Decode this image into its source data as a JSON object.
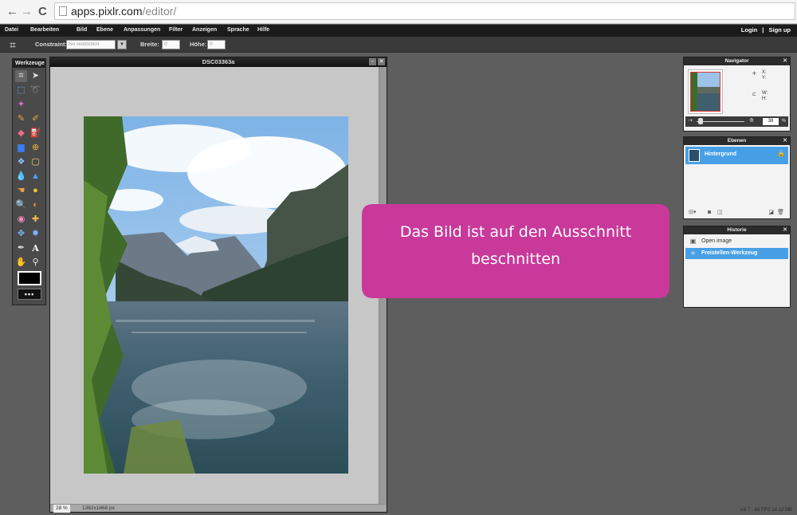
{
  "browser": {
    "back_icon": "arrow-left-icon",
    "forward_icon": "arrow-right-icon",
    "reload_icon": "reload-icon",
    "url_host": "apps.pixlr.com",
    "url_path": "/editor/"
  },
  "menu": {
    "items": [
      "Datei",
      "Bearbeiten",
      "Bild",
      "Ebene",
      "Anpassungen",
      "Filter",
      "Anzeigen",
      "Sprache",
      "Hilfe"
    ],
    "login": "Login",
    "separator": "|",
    "signup": "Sign up"
  },
  "options": {
    "constraint_label": "Constraint:",
    "constraint_value": "No restriction",
    "width_label": "Breite:",
    "width_value": "0",
    "height_label": "Höhe:",
    "height_value": "0"
  },
  "tools": {
    "title": "Werkzeuge",
    "items": [
      "crop-icon",
      "move-icon",
      "marquee-icon",
      "lasso-icon",
      "wand-icon",
      "pencil-icon",
      "brush-icon",
      "eraser-icon",
      "bucket-icon",
      "gradient-icon",
      "clone-icon",
      "colorreplace-icon",
      "drawing-icon",
      "blur-icon",
      "sharpen-icon",
      "smudge-icon",
      "sponge-icon",
      "dodge-icon",
      "burn-icon",
      "redeye-icon",
      "spot-heal-icon",
      "bloat-icon",
      "pinch-icon",
      "picker-icon",
      "type-icon",
      "hand-icon",
      "zoom-icon"
    ],
    "primary_color": "#000000",
    "secondary_color": "#ffffff"
  },
  "document": {
    "title": "DSC03363a",
    "zoom": "28",
    "zoom_unit": "%",
    "dimensions": "1382x1868 px"
  },
  "navigator": {
    "title": "Navigator",
    "x_label": "X:",
    "y_label": "Y:",
    "w_label": "W:",
    "h_label": "H:",
    "zoom": "38",
    "zoom_unit": "%"
  },
  "layers": {
    "title": "Ebenen",
    "items": [
      {
        "name": "Hintergrund",
        "selected": true
      }
    ]
  },
  "history": {
    "title": "Historie",
    "items": [
      {
        "name": "Open image",
        "selected": false
      },
      {
        "name": "Freistellen-Werkzeug",
        "selected": true
      }
    ]
  },
  "callout": {
    "line1": "Das Bild ist auf den Ausschnitt",
    "line2": "beschnitten",
    "color": "#c8399a"
  },
  "status": {
    "version": "v.8.7 - 69 FPS 14.12 MB"
  }
}
